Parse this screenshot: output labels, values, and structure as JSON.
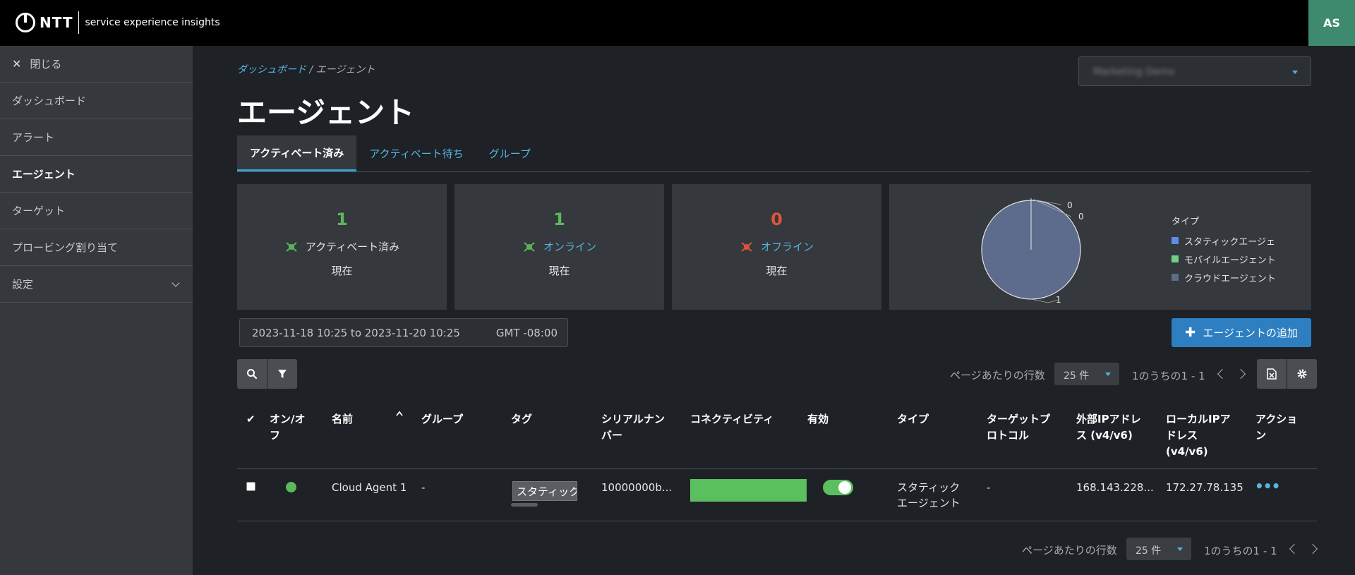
{
  "header": {
    "logo_brand": "NTT",
    "logo_product": "service experience insights",
    "user_initials": "AS"
  },
  "sidebar": {
    "close_label": "閉じる",
    "items": [
      {
        "label": "ダッシュボード"
      },
      {
        "label": "アラート"
      },
      {
        "label": "エージェント",
        "active": true
      },
      {
        "label": "ターゲット"
      },
      {
        "label": "プロービング割り当て"
      },
      {
        "label": "設定"
      }
    ]
  },
  "breadcrumb": {
    "parent": "ダッシュボード",
    "separator": " / ",
    "current": "エージェント"
  },
  "org_selector": {
    "value": "Marketing Demo"
  },
  "page": {
    "title": "エージェント"
  },
  "tabs": [
    {
      "label": "アクティベート済み",
      "active": true
    },
    {
      "label": "アクティベート待ち"
    },
    {
      "label": "グループ"
    }
  ],
  "stats": [
    {
      "value": "1",
      "label": "アクティベート済み",
      "sub": "現在",
      "color": "#5cb85c"
    },
    {
      "value": "1",
      "label": "オンライン",
      "sub": "現在",
      "color": "#5cb85c"
    },
    {
      "value": "0",
      "label": "オフライン",
      "sub": "現在",
      "color": "#e0533d"
    }
  ],
  "chart_data": {
    "type": "pie",
    "legend_title": "タイプ",
    "legend_position": "right",
    "series": [
      {
        "name": "スタティックエージェ",
        "value": 0,
        "color": "#5b8dea"
      },
      {
        "name": "モバイルエージェント",
        "value": 0,
        "color": "#6fd08c"
      },
      {
        "name": "クラウドエージェント",
        "value": 1,
        "color": "#5d6b8c"
      }
    ],
    "slice_labels": [
      "0",
      "0",
      "1"
    ]
  },
  "date_range": {
    "range": "2023-11-18 10:25 to 2023-11-20 10:25",
    "timezone": "GMT -08:00"
  },
  "add_button": {
    "label": "エージェントの追加"
  },
  "pager": {
    "rows_label": "ページあたりの行数",
    "rows_value": "25 件",
    "count": "1のうちの1 - 1"
  },
  "table": {
    "columns": [
      "✔",
      "オン/オ\nフ",
      "名前",
      "グループ",
      "タグ",
      "シリアルナン\nバー",
      "コネクティビティ",
      "有効",
      "タイプ",
      "ターゲットプ\nロトコル",
      "外部IPアドレ\nス (v4/v6)",
      "ローカルIPア\nドレス\n(v4/v6)",
      "アクショ\nン"
    ],
    "rows": [
      {
        "name": "Cloud Agent 1",
        "group": "-",
        "tag": "スタティック",
        "serial": "10000000b...",
        "type": "スタティック\nエージェント",
        "protocol": "-",
        "external_ip": "168.143.228...",
        "local_ip": "172.27.78.135",
        "actions": "•••"
      }
    ]
  },
  "colors": {
    "accent": "#56b4e0",
    "primary_button": "#2d7fc1",
    "online": "#5cb85c",
    "offline": "#e0533d"
  }
}
